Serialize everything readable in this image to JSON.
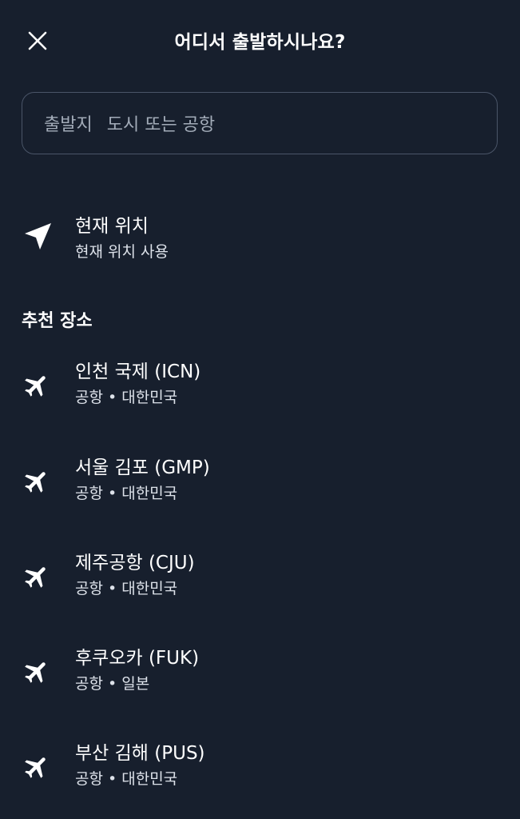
{
  "header": {
    "title": "어디서 출발하시나요?",
    "close_icon": "close-icon"
  },
  "search": {
    "prefix": "출발지",
    "placeholder": "도시 또는 공항"
  },
  "current_location": {
    "icon": "navigation-arrow-icon",
    "title": "현재 위치",
    "subtitle": "현재 위치 사용"
  },
  "recommended": {
    "section_title": "추천 장소",
    "items": [
      {
        "icon": "airplane-icon",
        "title": "인천 국제 (ICN)",
        "subtitle": "공항 • 대한민국"
      },
      {
        "icon": "airplane-icon",
        "title": "서울 김포 (GMP)",
        "subtitle": "공항 • 대한민국"
      },
      {
        "icon": "airplane-icon",
        "title": "제주공항 (CJU)",
        "subtitle": "공항 • 대한민국"
      },
      {
        "icon": "airplane-icon",
        "title": "후쿠오카 (FUK)",
        "subtitle": "공항 • 일본"
      },
      {
        "icon": "airplane-icon",
        "title": "부산 김해 (PUS)",
        "subtitle": "공항 • 대한민국"
      }
    ]
  },
  "colors": {
    "background": "#171f2d",
    "border": "#4a5568",
    "placeholder_text": "#a3acb9",
    "text": "#ffffff"
  }
}
